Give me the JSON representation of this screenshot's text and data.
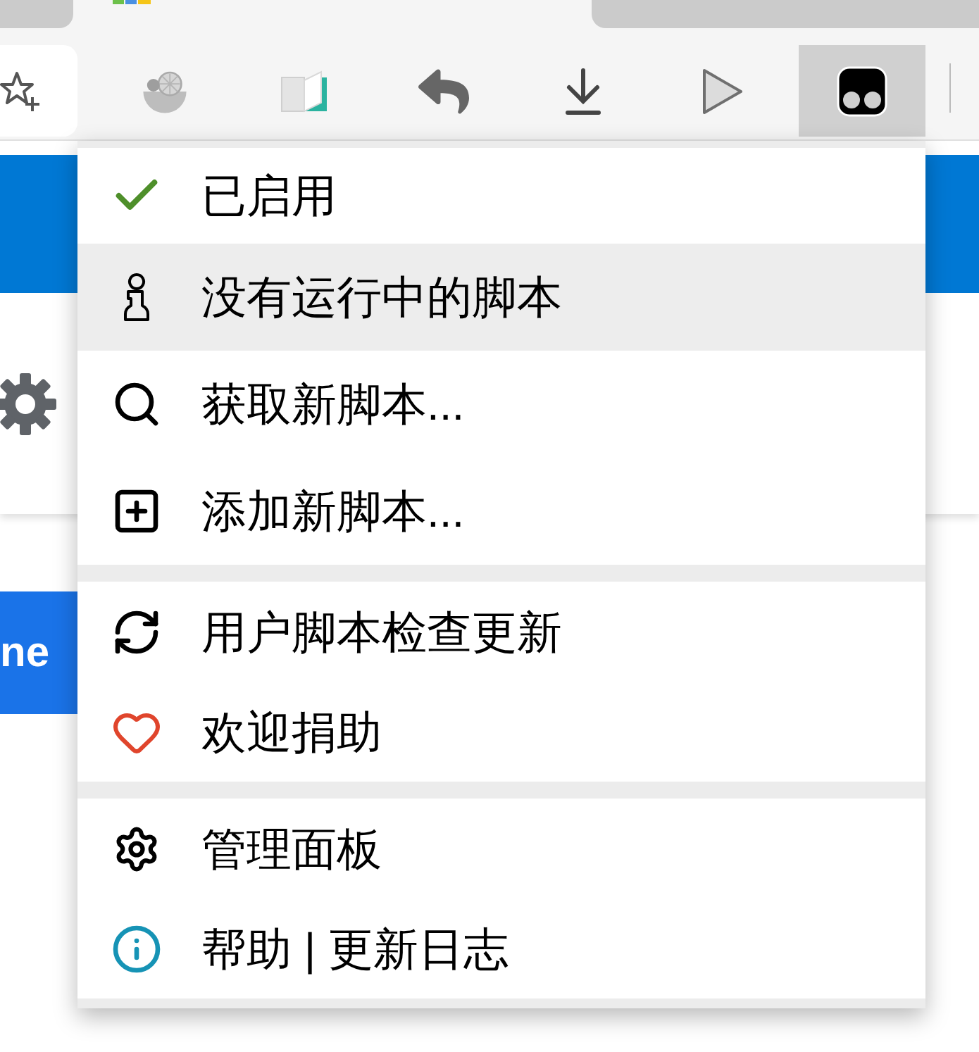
{
  "tabs": [
    {
      "selected": false
    },
    {
      "selected": true
    },
    {
      "selected": false
    }
  ],
  "toolbar": {
    "buttons": [
      {
        "selected": false
      },
      {
        "selected": false
      },
      {
        "selected": false
      },
      {
        "selected": false
      },
      {
        "selected": false
      },
      {
        "selected": true
      }
    ]
  },
  "page": {
    "button_label": "ne"
  },
  "menu": {
    "status": {
      "label": "已启用",
      "checked": true
    },
    "sections": [
      {
        "items": [
          {
            "label": "没有运行中的脚本",
            "highlighted": true
          },
          {
            "label": "获取新脚本...",
            "highlighted": false
          },
          {
            "label": "添加新脚本...",
            "highlighted": false
          }
        ]
      },
      {
        "items": [
          {
            "label": "用户脚本检查更新",
            "highlighted": false
          },
          {
            "label": "欢迎捐助",
            "highlighted": false
          }
        ]
      },
      {
        "items": [
          {
            "label": "管理面板",
            "highlighted": false
          },
          {
            "label": "帮助 | 更新日志",
            "highlighted": false
          }
        ]
      }
    ]
  }
}
